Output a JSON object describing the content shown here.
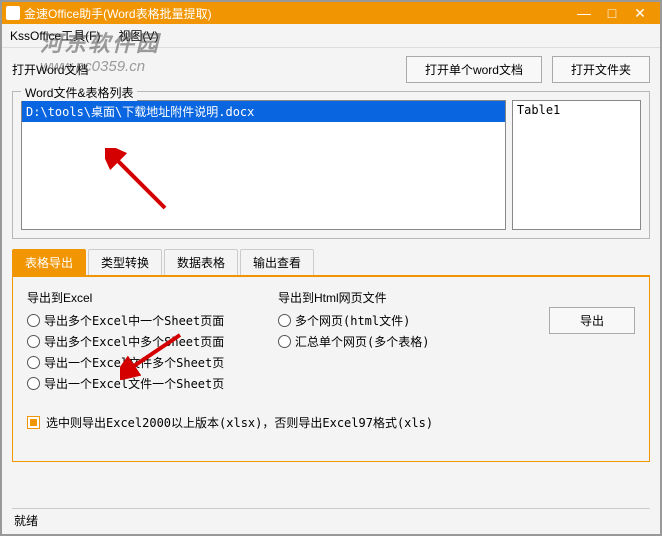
{
  "titlebar": {
    "title": "金速Office助手(Word表格批量提取)"
  },
  "watermark": {
    "text": "河东软件园",
    "url": "www.pc0359.cn"
  },
  "menubar": {
    "tool": "KssOffice工具(F)",
    "view": "视图(V)"
  },
  "open_section": {
    "label": "打开Word文档",
    "open_single": "打开单个word文档",
    "open_folder": "打开文件夹"
  },
  "filelist": {
    "legend": "Word文件&表格列表",
    "files": [
      "D:\\tools\\桌面\\下载地址附件说明.docx"
    ],
    "tables": [
      "Table1"
    ]
  },
  "tabs": {
    "items": [
      "表格导出",
      "类型转换",
      "数据表格",
      "输出查看"
    ],
    "active": 0
  },
  "export": {
    "excel_title": "导出到Excel",
    "html_title": "导出到Html网页文件",
    "excel_opts": [
      "导出多个Excel中一个Sheet页面",
      "导出多个Excel中多个Sheet页面",
      "导出一个Excel文件多个Sheet页",
      "导出一个Excel文件一个Sheet页"
    ],
    "html_opts": [
      "多个网页(html文件)",
      "汇总单个网页(多个表格)"
    ],
    "checkbox": "选中则导出Excel2000以上版本(xlsx)，否则导出Excel97格式(xls)",
    "btn": "导出"
  },
  "statusbar": {
    "text": "就绪"
  }
}
